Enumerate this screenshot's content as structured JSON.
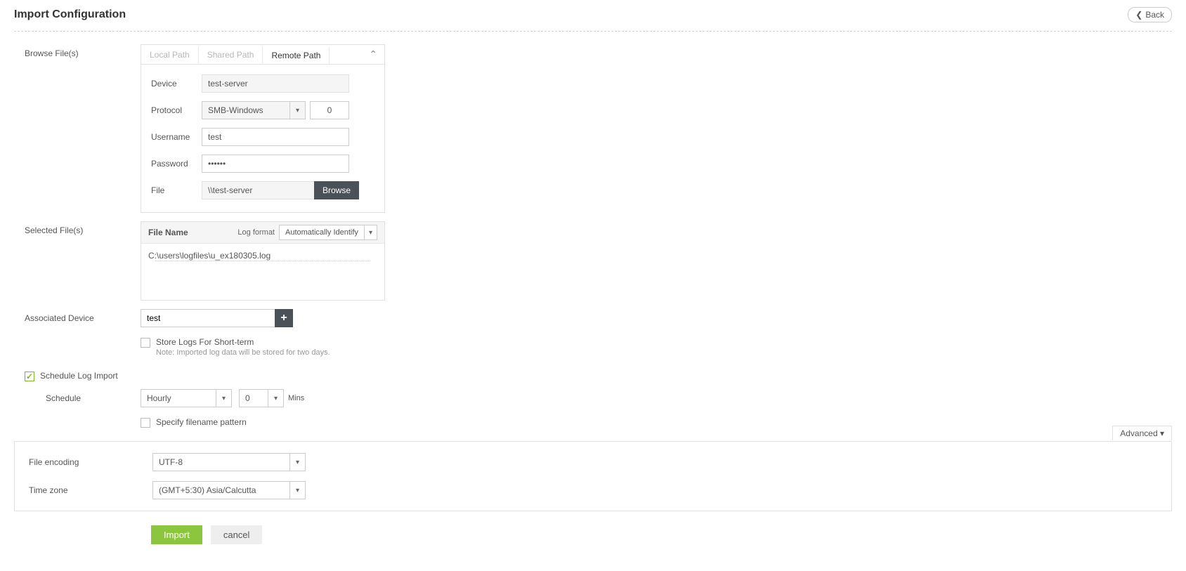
{
  "header": {
    "title": "Import Configuration",
    "back_label": "Back"
  },
  "browse": {
    "label": "Browse File(s)",
    "tabs": {
      "local": "Local Path",
      "shared": "Shared Path",
      "remote": "Remote Path"
    },
    "device_label": "Device",
    "device_value": "test-server",
    "protocol_label": "Protocol",
    "protocol_value": "SMB-Windows",
    "protocol_port": "0",
    "username_label": "Username",
    "username_value": "test",
    "password_label": "Password",
    "password_value": "••••••",
    "file_label": "File",
    "file_value": "\\\\test-server",
    "browse_btn": "Browse"
  },
  "selected": {
    "label": "Selected File(s)",
    "file_name_col": "File Name",
    "log_format_label": "Log format",
    "log_format_value": "Automatically Identify",
    "file_path": "C:\\users\\logfiles\\u_ex180305.log"
  },
  "assoc": {
    "label": "Associated Device",
    "value": "test",
    "store_label": "Store Logs For Short-term",
    "store_note": "Note: Imported log data will be stored for two days."
  },
  "schedule": {
    "toggle_label": "Schedule Log Import",
    "label": "Schedule",
    "freq": "Hourly",
    "mins": "0",
    "mins_label": "Mins",
    "specify_label": "Specify filename pattern"
  },
  "advanced": {
    "toggle": "Advanced",
    "encoding_label": "File encoding",
    "encoding_value": "UTF-8",
    "tz_label": "Time zone",
    "tz_value": "(GMT+5:30) Asia/Calcutta"
  },
  "actions": {
    "import": "Import",
    "cancel": "cancel"
  }
}
